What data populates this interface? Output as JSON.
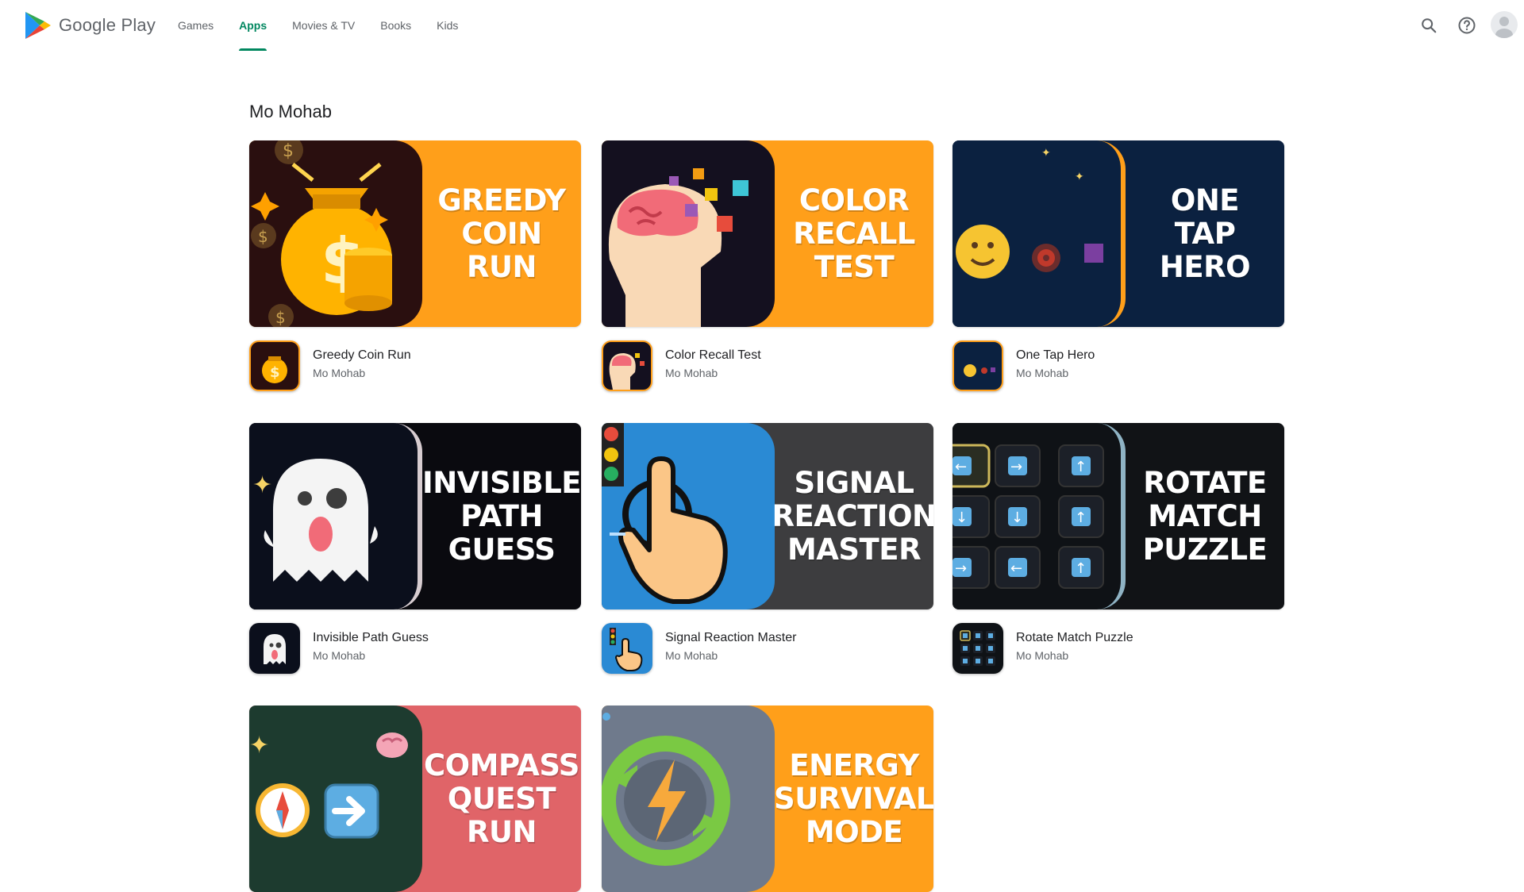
{
  "header": {
    "logo_text": "Google Play",
    "tabs": [
      {
        "label": "Games"
      },
      {
        "label": "Apps"
      },
      {
        "label": "Movies & TV"
      },
      {
        "label": "Books"
      },
      {
        "label": "Kids"
      }
    ],
    "active_tab": "Apps",
    "accent_color": "#01875f"
  },
  "section": {
    "title": "Mo Mohab"
  },
  "apps": [
    {
      "name": "Greedy Coin Run",
      "developer": "Mo Mohab",
      "banner_text": "GREEDY\nCOIN\nRUN",
      "banner_color": "#ff9f1a"
    },
    {
      "name": "Color Recall Test",
      "developer": "Mo Mohab",
      "banner_text": "COLOR\nRECALL\nTEST",
      "banner_color": "#ff9f1a"
    },
    {
      "name": "One Tap Hero",
      "developer": "Mo Mohab",
      "banner_text": "ONE\nTAP\nHERO",
      "banner_color": "#0b2140"
    },
    {
      "name": "Invisible Path Guess",
      "developer": "Mo Mohab",
      "banner_text": "INVISIBLE\nPATH\nGUESS",
      "banner_color": "#0a0a0f"
    },
    {
      "name": "Signal Reaction Master",
      "developer": "Mo Mohab",
      "banner_text": "SIGNAL\nREACTION\nMASTER",
      "banner_color": "#3d3d3f"
    },
    {
      "name": "Rotate Match Puzzle",
      "developer": "Mo Mohab",
      "banner_text": "ROTATE\nMATCH\nPUZZLE",
      "banner_color": "#111316"
    },
    {
      "banner_text": "COMPASS\nQUEST\nRUN",
      "banner_color": "#e06468"
    },
    {
      "banner_text": "ENERGY\nSURVIVAL\nMODE",
      "banner_color": "#ff9f1a"
    }
  ]
}
